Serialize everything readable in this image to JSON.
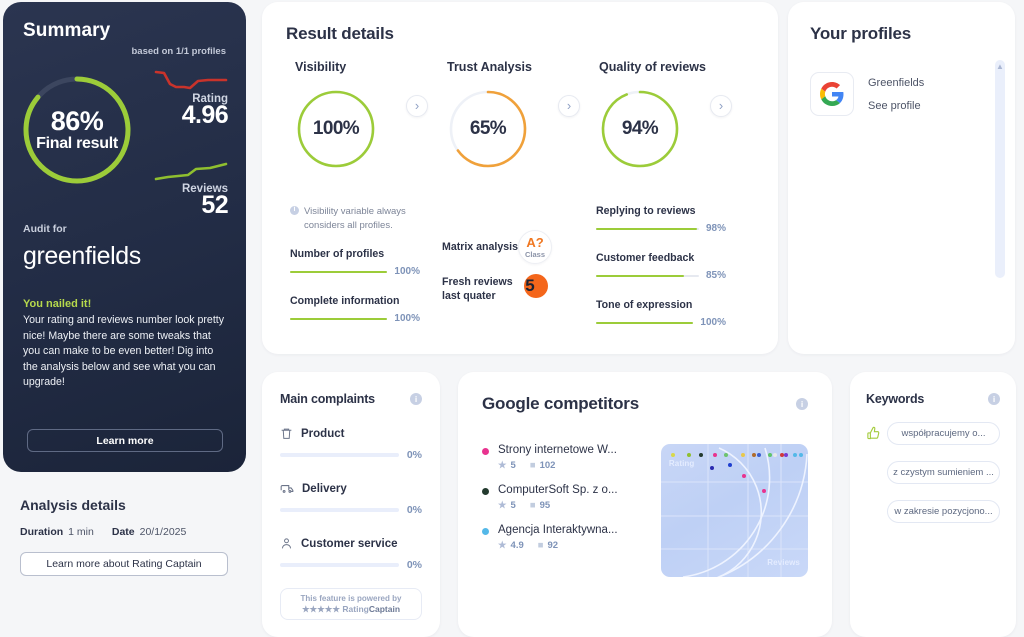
{
  "summary": {
    "title": "Summary",
    "based_on": "based on 1/1 profiles",
    "final_percent": "86%",
    "final_label": "Final result",
    "final_value": 86,
    "rating_label": "Rating",
    "rating_value": "4.96",
    "reviews_label": "Reviews",
    "reviews_value": "52",
    "audit_for_label": "Audit for",
    "audit_name": "greenfields",
    "nailed_heading": "You nailed it!",
    "nailed_body": "Your rating and reviews number look pretty nice! Maybe there are some tweaks that you can make to be even better! Dig into the analysis below and see what you can upgrade!",
    "learn_more": "Learn more",
    "accent_green": "#9ccc39",
    "rating_spark_color": "#c9332b",
    "reviews_spark_color": "#8fbf2f"
  },
  "analysis_details": {
    "title": "Analysis details",
    "duration_label": "Duration",
    "duration_value": "1 min",
    "date_label": "Date",
    "date_value": "20/1/2025",
    "learn_more_rc": "Learn more about Rating Captain"
  },
  "result_details": {
    "title": "Result details",
    "gauges": [
      {
        "name": "Visibility",
        "value": "100%",
        "pct": 100,
        "color": "#9ccc39"
      },
      {
        "name": "Trust Analysis",
        "value": "65%",
        "pct": 65,
        "color": "#f0a13a"
      },
      {
        "name": "Quality of reviews",
        "value": "94%",
        "pct": 94,
        "color": "#9ccc39"
      }
    ],
    "chevron_icon": "›",
    "info_note": "Visibility variable always considers all profiles.",
    "info_glyph": "i",
    "left_bars": [
      {
        "label": "Number of profiles",
        "pct_text": "100%",
        "pct": 100
      },
      {
        "label": "Complete information",
        "pct_text": "100%",
        "pct": 100
      }
    ],
    "right_bars": [
      {
        "label": "Replying to reviews",
        "pct_text": "98%",
        "pct": 98
      },
      {
        "label": "Customer feedback",
        "pct_text": "85%",
        "pct": 85
      },
      {
        "label": "Tone of expression",
        "pct_text": "100%",
        "pct": 100
      }
    ],
    "matrix": {
      "label": "Matrix analysis",
      "grade": "A?",
      "grade_sub": "Class"
    },
    "fresh": {
      "label_line1": "Fresh reviews",
      "label_line2": "last quater",
      "count": "5"
    }
  },
  "your_profiles": {
    "title": "Your profiles",
    "profile_name": "Greenfields",
    "see_profile": "See profile",
    "logo_icon": "google-logo-icon"
  },
  "main_complaints": {
    "title": "Main complaints",
    "info_glyph": "i",
    "items": [
      {
        "icon": "trash-icon",
        "label": "Product",
        "pct_text": "0%",
        "pct": 0
      },
      {
        "icon": "truck-icon",
        "label": "Delivery",
        "pct_text": "0%",
        "pct": 0
      },
      {
        "icon": "person-icon",
        "label": "Customer service",
        "pct_text": "0%",
        "pct": 0
      }
    ],
    "powered_line1": "This feature is powered by",
    "powered_line2_stars": "★★★★★",
    "powered_brand_a": "Rating",
    "powered_brand_b": "Captain"
  },
  "google_competitors": {
    "title": "Google competitors",
    "info_glyph": "i",
    "items": [
      {
        "name": "Strony internetowe W...",
        "rating": "5",
        "reviews": "102",
        "color": "#e8338f"
      },
      {
        "name": "ComputerSoft Sp. z o...",
        "rating": "5",
        "reviews": "95",
        "color": "#233a2e"
      },
      {
        "name": "Agencja Interaktywna...",
        "rating": "4.9",
        "reviews": "92",
        "color": "#54b8e8"
      }
    ],
    "star_icon": "★",
    "bubble_icon": "■",
    "chart_axis_y": "Rating",
    "chart_axis_x": "Reviews"
  },
  "keywords": {
    "title": "Keywords",
    "info_glyph": "i",
    "items": [
      {
        "text": "współpracujemy o...",
        "has_thumb": true
      },
      {
        "text": "z czystym sumieniem ...",
        "has_thumb": false
      },
      {
        "text": "w zakresie pozycjono...",
        "has_thumb": false
      }
    ]
  },
  "chart_data": {
    "type": "scatter",
    "title": "Google competitors positioning",
    "xlabel": "Reviews",
    "ylabel": "Rating",
    "points": [
      {
        "x": 4,
        "y": 97,
        "color": "#d8d84a"
      },
      {
        "x": 16,
        "y": 97,
        "color": "#8fbf2f"
      },
      {
        "x": 25,
        "y": 97,
        "color": "#233a2e"
      },
      {
        "x": 35,
        "y": 97,
        "color": "#e8338f"
      },
      {
        "x": 43,
        "y": 97,
        "color": "#6ec36e"
      },
      {
        "x": 56,
        "y": 97,
        "color": "#e8c84a"
      },
      {
        "x": 64,
        "y": 97,
        "color": "#b06b2a"
      },
      {
        "x": 68,
        "y": 97,
        "color": "#3a5fd0"
      },
      {
        "x": 76,
        "y": 97,
        "color": "#5ec46a"
      },
      {
        "x": 80,
        "y": 97,
        "color": "#e8e8e8"
      },
      {
        "x": 85,
        "y": 97,
        "color": "#d03a3a"
      },
      {
        "x": 88,
        "y": 97,
        "color": "#7a3ad0"
      },
      {
        "x": 95,
        "y": 97,
        "color": "#54b8e8"
      },
      {
        "x": 99,
        "y": 97,
        "color": "#54b8e8"
      },
      {
        "x": 33,
        "y": 86,
        "color": "#2a2ab0"
      },
      {
        "x": 46,
        "y": 88,
        "color": "#1f3fd0"
      },
      {
        "x": 57,
        "y": 79,
        "color": "#e8338f"
      },
      {
        "x": 72,
        "y": 66,
        "color": "#e8338f"
      }
    ],
    "xlim": [
      0,
      100
    ],
    "ylim": [
      0,
      100
    ],
    "grid": true
  }
}
